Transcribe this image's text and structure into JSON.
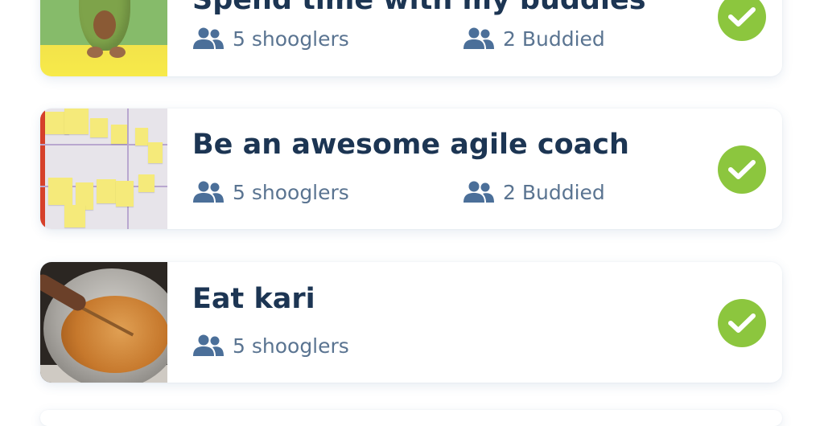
{
  "goals": [
    {
      "title": "Spend time with my buddies",
      "shooglers": "5 shooglers",
      "buddied": "2 Buddied",
      "image": "avocado-plush",
      "status_icon": "check-circle-icon",
      "status_color": "#8cc63e"
    },
    {
      "title": "Be an awesome agile coach",
      "shooglers": "5 shooglers",
      "buddied": "2 Buddied",
      "image": "whiteboard-sticky-notes",
      "status_icon": "check-circle-icon",
      "status_color": "#8cc63e"
    },
    {
      "title": "Eat kari",
      "shooglers": "5 shooglers",
      "image": "cooking-bowl",
      "status_icon": "check-circle-icon",
      "status_color": "#8cc63e"
    }
  ],
  "icons": {
    "people": "people-icon",
    "check": "checkmark-icon"
  },
  "colors": {
    "title": "#1c3553",
    "meta": "#5a7491",
    "icon": "#4b6f99",
    "accent": "#8cc63e"
  }
}
